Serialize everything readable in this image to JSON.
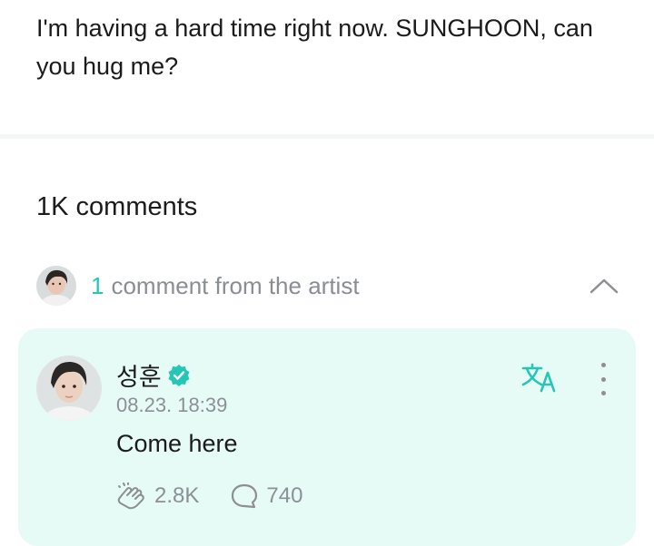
{
  "post": {
    "text": "I'm having a hard time right now. SUNGHOON, can you hug me?"
  },
  "comments": {
    "count_label": "1K comments",
    "artist_summary": {
      "count": "1",
      "label": "comment from the artist"
    }
  },
  "artist_comment": {
    "author": "성훈",
    "timestamp": "08.23. 18:39",
    "body": "Come here",
    "likes": "2.8K",
    "replies": "740",
    "icons": {
      "verified": "verified-badge-icon",
      "translate": "translate-icon",
      "more": "more-vertical-icon",
      "like": "like-hand-icon",
      "reply": "comment-bubble-icon"
    }
  },
  "colors": {
    "accent": "#26c6b7",
    "card_background": "#e6faf6",
    "muted_text": "#8c9096"
  }
}
